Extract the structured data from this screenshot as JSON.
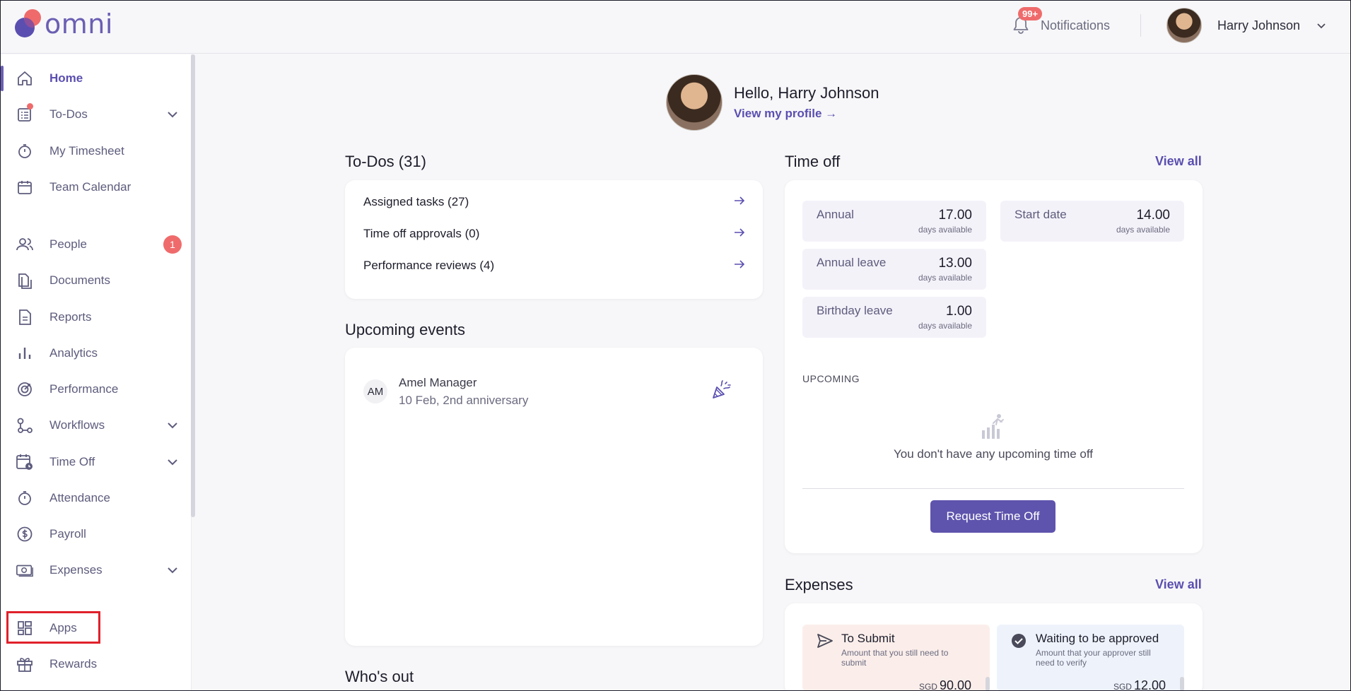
{
  "brand": {
    "name": "omni",
    "accent": "#6a5fb3"
  },
  "header": {
    "notifications_badge": "99+",
    "notifications_label": "Notifications",
    "user_name": "Harry Johnson"
  },
  "sidebar": {
    "items": [
      {
        "label": "Home",
        "icon": "home-icon",
        "active": true
      },
      {
        "label": "To-Dos",
        "icon": "todo-list-icon",
        "has_dot": true,
        "expandable": true
      },
      {
        "label": "My Timesheet",
        "icon": "stopwatch-icon"
      },
      {
        "label": "Team Calendar",
        "icon": "calendar-icon"
      },
      {
        "label": "People",
        "icon": "people-icon",
        "count": "1"
      },
      {
        "label": "Documents",
        "icon": "documents-icon"
      },
      {
        "label": "Reports",
        "icon": "report-icon"
      },
      {
        "label": "Analytics",
        "icon": "bar-chart-icon"
      },
      {
        "label": "Performance",
        "icon": "target-icon"
      },
      {
        "label": "Workflows",
        "icon": "workflow-icon",
        "expandable": true
      },
      {
        "label": "Time Off",
        "icon": "calendar-clock-icon",
        "expandable": true
      },
      {
        "label": "Attendance",
        "icon": "stopwatch-icon"
      },
      {
        "label": "Payroll",
        "icon": "dollar-icon"
      },
      {
        "label": "Expenses",
        "icon": "money-icon",
        "expandable": true
      },
      {
        "label": "Apps",
        "icon": "apps-grid-icon",
        "highlighted": true
      },
      {
        "label": "Rewards",
        "icon": "gift-icon"
      }
    ]
  },
  "greeting": {
    "title": "Hello, Harry Johnson",
    "profile_link": "View my profile"
  },
  "todos": {
    "title": "To-Dos (31)",
    "rows": [
      {
        "label": "Assigned tasks (27)"
      },
      {
        "label": "Time off approvals (0)"
      },
      {
        "label": "Performance reviews (4)"
      }
    ]
  },
  "events": {
    "title": "Upcoming events",
    "items": [
      {
        "initials": "AM",
        "name": "Amel Manager",
        "detail": "10 Feb, 2nd anniversary"
      }
    ]
  },
  "time_off": {
    "title": "Time off",
    "view_all": "View all",
    "balances": [
      {
        "name": "Annual",
        "value": "17.00",
        "unit": "days available"
      },
      {
        "name": "Start date",
        "value": "14.00",
        "unit": "days available"
      },
      {
        "name": "Annual leave",
        "value": "13.00",
        "unit": "days available"
      },
      {
        "name": "Birthday leave",
        "value": "1.00",
        "unit": "days available"
      }
    ],
    "upcoming_label": "UPCOMING",
    "empty_text": "You don't have any upcoming time off",
    "request_button": "Request Time Off"
  },
  "expenses": {
    "title": "Expenses",
    "view_all": "View all",
    "boxes": [
      {
        "title": "To Submit",
        "desc": "Amount that you still need to submit",
        "currency": "SGD",
        "amount": "90.00",
        "bg": "#fbeeea"
      },
      {
        "title": "Waiting to be approved",
        "desc": "Amount that your approver still need to verify",
        "currency": "SGD",
        "amount": "12.00",
        "bg": "#eef3fb"
      }
    ]
  },
  "whos_out": {
    "title": "Who's out"
  }
}
